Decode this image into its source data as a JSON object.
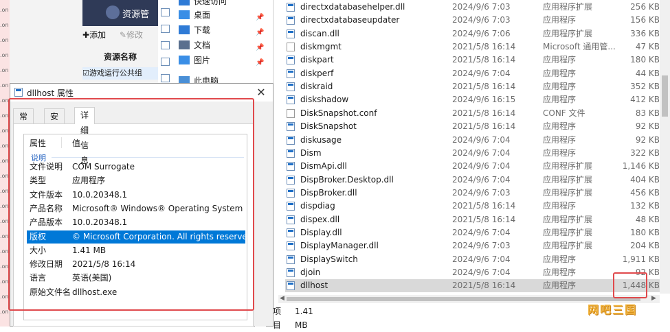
{
  "left_strip": {
    "items": [
      ".on",
      ".on",
      ".on",
      ".on",
      ".on",
      ".on",
      ".on",
      ".on",
      ".on",
      ".on",
      ".on",
      ".on",
      ".on",
      ".on",
      ".on",
      ".on",
      ".on",
      ".on",
      ".on",
      ".on",
      ".on"
    ]
  },
  "bg_app": {
    "banner": "资源管",
    "add_label": "添加",
    "edit_label": "修改",
    "column_header": "资源名称",
    "row_label": "游戏运行公共组"
  },
  "nav_pane": {
    "items": [
      {
        "label": "快速访问",
        "icon": "star-icon"
      },
      {
        "label": "桌面",
        "icon": "desktop-icon",
        "pinned": true
      },
      {
        "label": "下载",
        "icon": "download-icon",
        "pinned": true
      },
      {
        "label": "文档",
        "icon": "document-icon",
        "pinned": true
      },
      {
        "label": "图片",
        "icon": "pictures-icon",
        "pinned": true
      },
      {
        "label": "此电脑",
        "icon": "computer-icon"
      }
    ]
  },
  "file_list": {
    "rows": [
      {
        "name": "directxdatabasehelper.dll",
        "date": "2024/9/6 7:03",
        "type": "应用程序扩展",
        "size": "256 KB",
        "icon": "dll"
      },
      {
        "name": "directxdatabaseupdater",
        "date": "2024/9/6 7:03",
        "type": "应用程序",
        "size": "156 KB",
        "icon": "exe"
      },
      {
        "name": "discan.dll",
        "date": "2024/9/6 7:06",
        "type": "应用程序扩展",
        "size": "336 KB",
        "icon": "dll"
      },
      {
        "name": "diskmgmt",
        "date": "2021/5/8 16:14",
        "type": "Microsoft 通用管...",
        "size": "47 KB",
        "icon": "doc"
      },
      {
        "name": "diskpart",
        "date": "2021/5/8 16:14",
        "type": "应用程序",
        "size": "180 KB",
        "icon": "exe"
      },
      {
        "name": "diskperf",
        "date": "2024/9/6 7:04",
        "type": "应用程序",
        "size": "44 KB",
        "icon": "exe"
      },
      {
        "name": "diskraid",
        "date": "2021/5/8 16:14",
        "type": "应用程序",
        "size": "352 KB",
        "icon": "exe"
      },
      {
        "name": "diskshadow",
        "date": "2024/9/6 16:15",
        "type": "应用程序",
        "size": "412 KB",
        "icon": "exe"
      },
      {
        "name": "DiskSnapshot.conf",
        "date": "2021/5/8 16:14",
        "type": "CONF 文件",
        "size": "83 KB",
        "icon": "doc"
      },
      {
        "name": "DiskSnapshot",
        "date": "2021/5/8 16:14",
        "type": "应用程序",
        "size": "92 KB",
        "icon": "exe"
      },
      {
        "name": "diskusage",
        "date": "2024/9/6 7:04",
        "type": "应用程序",
        "size": "92 KB",
        "icon": "exe"
      },
      {
        "name": "Dism",
        "date": "2024/9/6 7:04",
        "type": "应用程序",
        "size": "322 KB",
        "icon": "exe"
      },
      {
        "name": "DismApi.dll",
        "date": "2024/9/6 7:04",
        "type": "应用程序扩展",
        "size": "1,146 KB",
        "icon": "dll"
      },
      {
        "name": "DispBroker.Desktop.dll",
        "date": "2024/9/6 7:04",
        "type": "应用程序扩展",
        "size": "404 KB",
        "icon": "dll"
      },
      {
        "name": "DispBroker.dll",
        "date": "2024/9/6 7:03",
        "type": "应用程序扩展",
        "size": "456 KB",
        "icon": "dll"
      },
      {
        "name": "dispdiag",
        "date": "2021/5/8 16:14",
        "type": "应用程序",
        "size": "132 KB",
        "icon": "exe"
      },
      {
        "name": "dispex.dll",
        "date": "2021/5/8 16:14",
        "type": "应用程序扩展",
        "size": "48 KB",
        "icon": "dll"
      },
      {
        "name": "Display.dll",
        "date": "2024/9/6 7:04",
        "type": "应用程序扩展",
        "size": "180 KB",
        "icon": "dll"
      },
      {
        "name": "DisplayManager.dll",
        "date": "2024/9/6 7:03",
        "type": "应用程序扩展",
        "size": "204 KB",
        "icon": "dll"
      },
      {
        "name": "DisplaySwitch",
        "date": "2024/9/6 7:04",
        "type": "应用程序",
        "size": "1,911 KB",
        "icon": "exe"
      },
      {
        "name": "djoin",
        "date": "2024/9/6 7:04",
        "type": "应用程序",
        "size": "92 KB",
        "icon": "exe"
      },
      {
        "name": "dllhost",
        "date": "2021/5/8 16:14",
        "type": "应用程序",
        "size": "1,448 KB",
        "icon": "exe",
        "selected": true
      }
    ]
  },
  "status_bar": {
    "count_label": "项目",
    "selected_size": "1.41 MB"
  },
  "dialog": {
    "title": "dllhost 属性",
    "close_glyph": "✕",
    "tabs": [
      {
        "label": "常规"
      },
      {
        "label": "安全"
      },
      {
        "label": "详细信息",
        "active": true
      }
    ],
    "header_property": "属性",
    "header_value": "值",
    "group_label": "说明",
    "properties": [
      {
        "key": "文件说明",
        "value": "COM Surrogate"
      },
      {
        "key": "类型",
        "value": "应用程序"
      },
      {
        "key": "文件版本",
        "value": "10.0.20348.1"
      },
      {
        "key": "产品名称",
        "value": "Microsoft® Windows® Operating System"
      },
      {
        "key": "产品版本",
        "value": "10.0.20348.1"
      },
      {
        "key": "版权",
        "value": "© Microsoft Corporation. All rights reserved.",
        "highlighted": true
      },
      {
        "key": "大小",
        "value": "1.41 MB"
      },
      {
        "key": "修改日期",
        "value": "2021/5/8 16:14"
      },
      {
        "key": "语言",
        "value": "英语(美国)"
      },
      {
        "key": "原始文件名",
        "value": "dllhost.exe"
      }
    ]
  },
  "watermark": "网吧三国",
  "colors": {
    "accent": "#0078d7",
    "annotation_red": "#e0494c",
    "selection_gray": "#d9d9d9"
  }
}
